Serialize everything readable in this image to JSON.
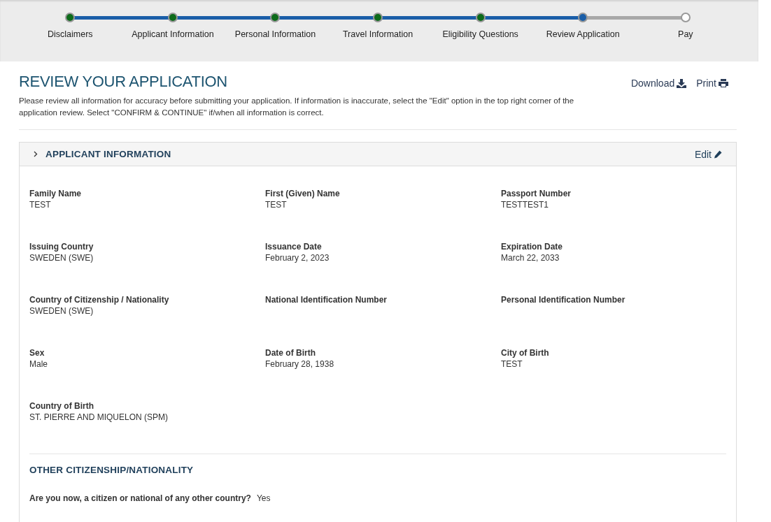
{
  "steps": [
    {
      "label": "Disclaimers",
      "done": true,
      "selected": false
    },
    {
      "label": "Applicant Information",
      "done": true,
      "selected": false
    },
    {
      "label": "Personal Information",
      "done": true,
      "selected": false
    },
    {
      "label": "Travel Information",
      "done": true,
      "selected": false
    },
    {
      "label": "Eligibility Questions",
      "done": true,
      "selected": false
    },
    {
      "label": "Review Application",
      "done": false,
      "selected": true
    },
    {
      "label": "Pay",
      "done": false,
      "selected": false
    }
  ],
  "title": "REVIEW YOUR APPLICATION",
  "intro": "Please review all information for accuracy before submitting your application. If information is inaccurate, select the \"Edit\" option in the top right corner of the application review. Select \"CONFIRM & CONTINUE\" if/when all information is correct.",
  "actions": [
    {
      "label": "Download",
      "kind": "download"
    },
    {
      "label": "Print",
      "kind": "print"
    }
  ],
  "section": {
    "title": "APPLICANT INFORMATION",
    "expanded": false,
    "edit": "Edit",
    "fields": [
      {
        "label": "Family Name",
        "value": "TEST"
      },
      {
        "label": "First (Given) Name",
        "value": "TEST"
      },
      {
        "label": "Passport Number",
        "value": "TESTTEST1"
      },
      {
        "label": "Issuing Country",
        "value": "SWEDEN (SWE)"
      },
      {
        "label": "Issuance Date",
        "value": "February 2, 2023"
      },
      {
        "label": "Expiration Date",
        "value": "March 22, 2033"
      },
      {
        "label": "Country of Citizenship / Nationality",
        "value": "SWEDEN (SWE)"
      },
      {
        "label": "National Identification Number"
      },
      {
        "label": "Personal Identification Number"
      },
      {
        "label": "Sex",
        "value": "Male"
      },
      {
        "label": "Date of Birth",
        "value": "February 28, 1938"
      },
      {
        "label": "City of Birth",
        "value": "TEST"
      },
      {
        "label": "Country of Birth",
        "value": "ST. PIERRE AND MIQUELON (SPM)"
      }
    ],
    "subheading": "OTHER CITIZENSHIP/NATIONALITY",
    "question": {
      "label": "Are you now, a citizen or national of any other country?",
      "answer": "Yes"
    }
  }
}
